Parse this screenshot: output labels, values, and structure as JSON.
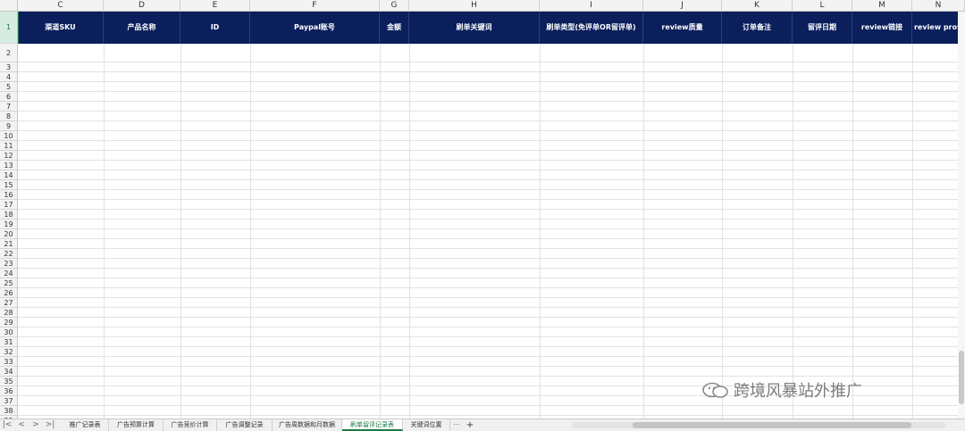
{
  "columns": [
    "C",
    "D",
    "E",
    "F",
    "G",
    "H",
    "I",
    "J",
    "K",
    "L",
    "M",
    "N"
  ],
  "header_row_number": "1",
  "headers": [
    "渠道SKU",
    "产品名称",
    "ID",
    "Paypal账号",
    "金额",
    "刷单关键词",
    "刷单类型(免评单OR留评单)",
    "review质量",
    "订单备注",
    "留评日期",
    "review链接",
    "review profi"
  ],
  "rows": [
    "2",
    "3",
    "4",
    "5",
    "6",
    "7",
    "8",
    "9",
    "10",
    "11",
    "12",
    "13",
    "14",
    "15",
    "16",
    "17",
    "18",
    "19",
    "20",
    "21",
    "22",
    "23",
    "24",
    "25",
    "26",
    "27",
    "28",
    "29",
    "30",
    "31",
    "32",
    "33",
    "34",
    "35",
    "36",
    "37",
    "38",
    "39"
  ],
  "tabs": [
    "推广记录表",
    "广告预算计算",
    "广告竞价计算",
    "广告调整记录",
    "广告周数据和月数据",
    "刷单留评记录表",
    "关键词位置"
  ],
  "active_tab": "刷单留评记录表",
  "tab_more": "···",
  "tab_add": "+",
  "nav": {
    "first": "|<",
    "prev": "<",
    "next": ">",
    "last": ">|"
  },
  "watermark": "跨境风暴站外推广",
  "colors": {
    "header_bg": "#0a1f5c",
    "header_text": "#ffffff",
    "active_tab": "#1e7a45"
  }
}
